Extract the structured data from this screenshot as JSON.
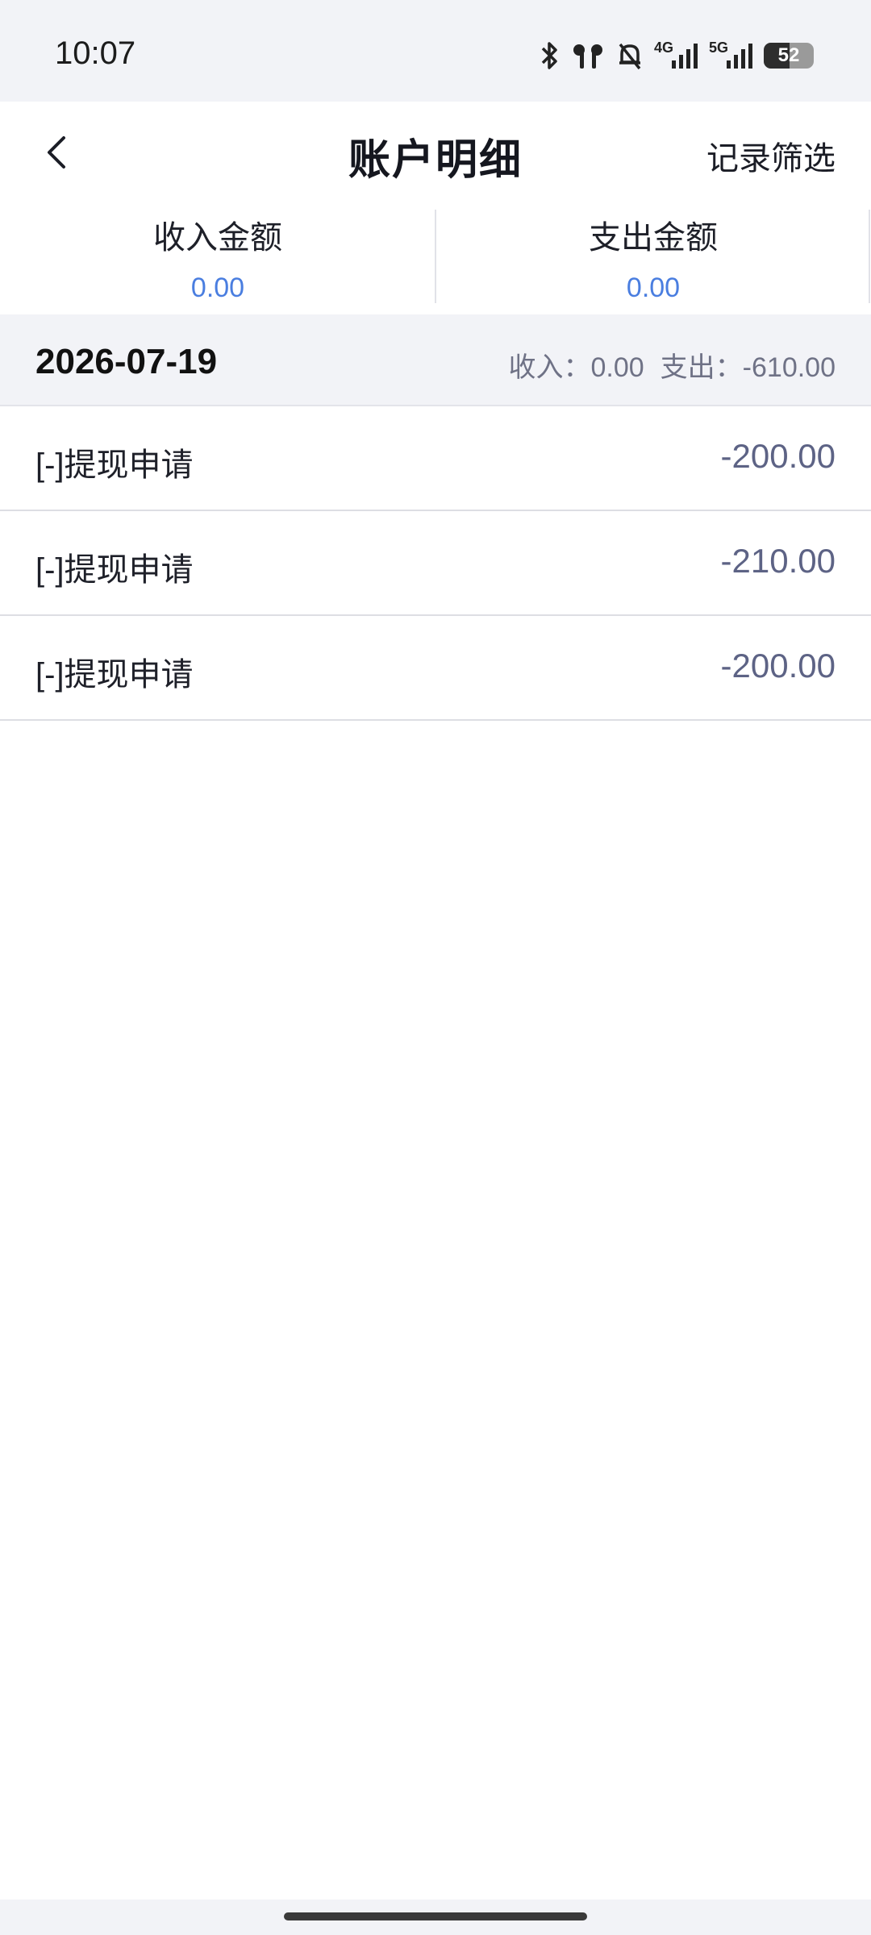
{
  "status_bar": {
    "time": "10:07",
    "icons": [
      "bluetooth-icon",
      "earbuds-icon",
      "mute-bell-icon",
      "signal-4g-icon",
      "signal-5g-icon",
      "battery-icon"
    ],
    "net_4g": "4G",
    "net_5g": "5G",
    "battery_level": "52"
  },
  "header": {
    "title": "账户明细",
    "filter_label": "记录筛选",
    "back_icon": "chevron-left-icon"
  },
  "summary": {
    "income_label": "收入金额",
    "income_value": "0.00",
    "expense_label": "支出金额",
    "expense_value": "0.00"
  },
  "groups": [
    {
      "date": "2026-07-19",
      "income_label": "收入：",
      "income_value": "0.00",
      "expense_label": "支出：",
      "expense_value": "-610.00",
      "items": [
        {
          "title": "[-]提现申请",
          "amount": "-200.00"
        },
        {
          "title": "[-]提现申请",
          "amount": "-210.00"
        },
        {
          "title": "[-]提现申请",
          "amount": "-200.00"
        }
      ]
    }
  ],
  "colors": {
    "accent_blue": "#4a7ee0",
    "amount_gray": "#5d6385",
    "section_bg": "#f2f3f7"
  }
}
